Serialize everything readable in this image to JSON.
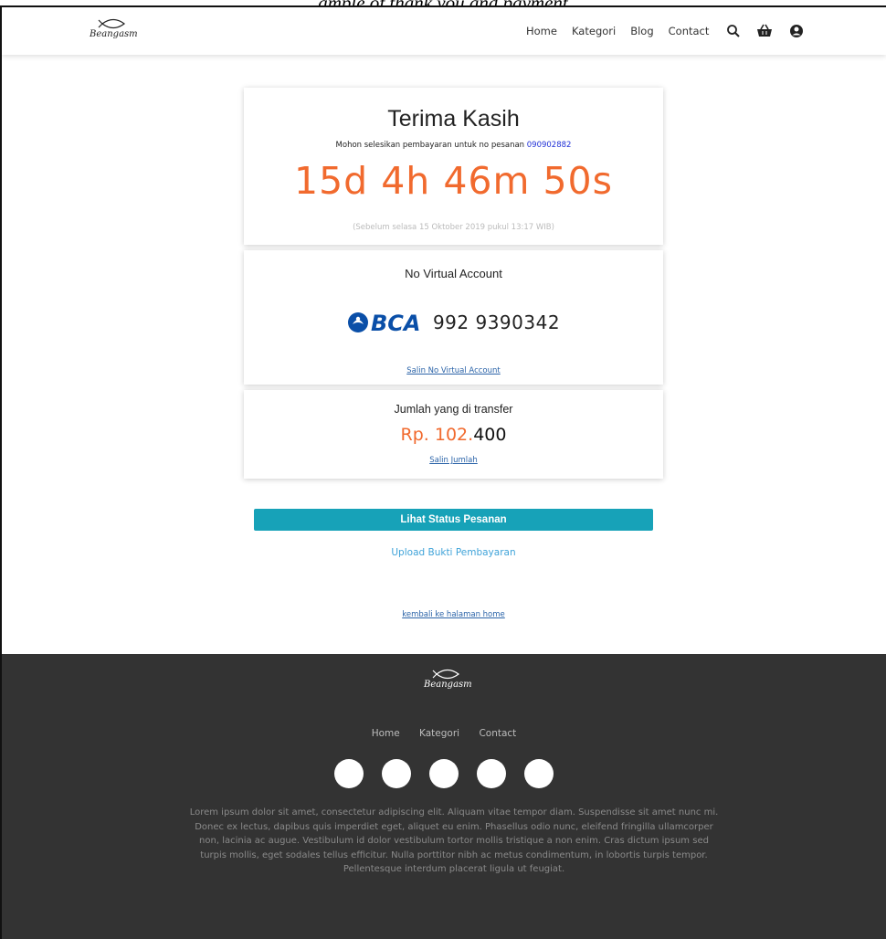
{
  "caption": "ample of thank you and payment",
  "brand": {
    "name": "Beangasm"
  },
  "nav": {
    "links": [
      "Home",
      "Kategori",
      "Blog",
      "Contact"
    ],
    "icons": [
      "search-icon",
      "basket-icon",
      "user-icon"
    ]
  },
  "thanks": {
    "title": "Terima Kasih",
    "order_prefix": "Mohon selesikan pembayaran untuk no pesanan",
    "order_number": "090902882",
    "countdown": "15d 4h 46m 50s",
    "deadline": "(Sebelum selasa 15 Oktober 2019 pukul 13:17 WIB)"
  },
  "virtual_account": {
    "title": "No Virtual Account",
    "bank": "BCA",
    "number": "992 9390342",
    "copy_label": "Salin No Virtual Account"
  },
  "transfer": {
    "title": "Jumlah yang di transfer",
    "amount_main": "Rp. 102.",
    "amount_tail": "400",
    "copy_label": "Salin Jumlah"
  },
  "actions": {
    "status_button": "Lihat Status Pesanan",
    "upload_link": "Upload Bukti Pembayaran",
    "home_link": "kembali ke halaman home"
  },
  "footer": {
    "links": [
      "Home",
      "Kategori",
      "Contact"
    ],
    "social_count": 5,
    "text": "Lorem ipsum dolor sit amet, consectetur adipiscing elit. Aliquam vitae tempor diam. Suspendisse sit amet nunc mi. Donec ex lectus, dapibus quis imperdiet eget, aliquet eu enim. Phasellus odio nunc, eleifend fringilla ullamcorper non, lacinia ac augue. Vestibulum id dolor vestibulum tortor mollis tristique a non enim. Cras dictum ipsum sed turpis mollis, eget sodales tellus efficitur. Nulla porttitor nibh ac metus condimentum, in lobortis turpis tempor. Pellentesque interdum placerat ligula ut feugiat."
  },
  "colors": {
    "accent_orange": "#f16a2e",
    "button_teal": "#17a2b8",
    "link_blue": "#3fa3d9",
    "order_blue": "#1f2fd6",
    "footer_bg": "#333333",
    "bca_blue": "#0a4fa8"
  }
}
